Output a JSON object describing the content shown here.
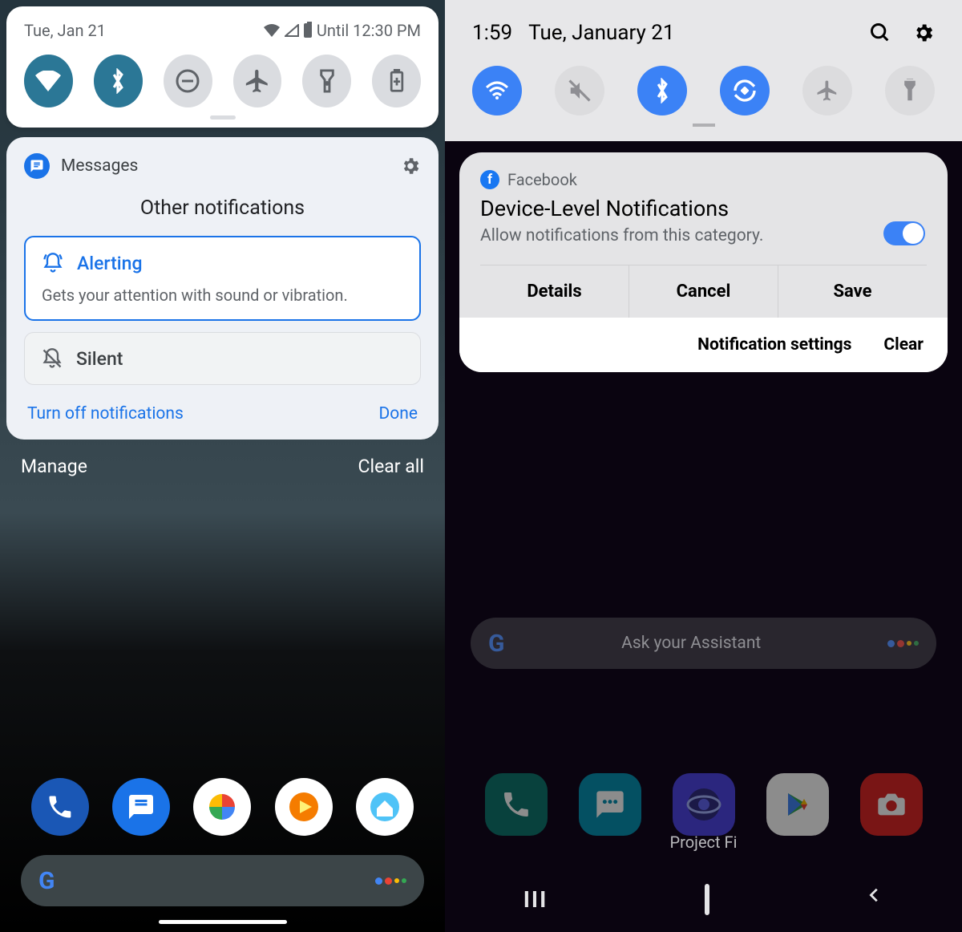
{
  "left": {
    "status": {
      "date": "Tue, Jan 21",
      "until": "Until 12:30 PM"
    },
    "tiles": [
      {
        "name": "wifi",
        "on": true
      },
      {
        "name": "bluetooth",
        "on": true
      },
      {
        "name": "dnd",
        "on": false
      },
      {
        "name": "airplane",
        "on": false
      },
      {
        "name": "flashlight",
        "on": false
      },
      {
        "name": "battery-saver",
        "on": false
      }
    ],
    "notification": {
      "app": "Messages",
      "header": "Other notifications",
      "options": {
        "alerting": {
          "label": "Alerting",
          "desc": "Gets your attention with sound or vibration."
        },
        "silent": {
          "label": "Silent"
        }
      },
      "turn_off": "Turn off notifications",
      "done": "Done"
    },
    "shade": {
      "manage": "Manage",
      "clear_all": "Clear all"
    }
  },
  "right": {
    "status": {
      "time": "1:59",
      "date": "Tue, January 21"
    },
    "tiles": [
      {
        "name": "wifi",
        "on": true
      },
      {
        "name": "sound",
        "on": false
      },
      {
        "name": "bluetooth",
        "on": true
      },
      {
        "name": "auto-rotate",
        "on": true
      },
      {
        "name": "airplane",
        "on": false
      },
      {
        "name": "flashlight",
        "on": false
      }
    ],
    "card": {
      "app": "Facebook",
      "title": "Device-Level Notifications",
      "desc": "Allow notifications from this category.",
      "toggle_on": true,
      "actions": {
        "details": "Details",
        "cancel": "Cancel",
        "save": "Save"
      },
      "footer": {
        "settings": "Notification settings",
        "clear": "Clear"
      }
    },
    "search_hint": "Ask your Assistant",
    "folder_label": "Project Fi"
  }
}
